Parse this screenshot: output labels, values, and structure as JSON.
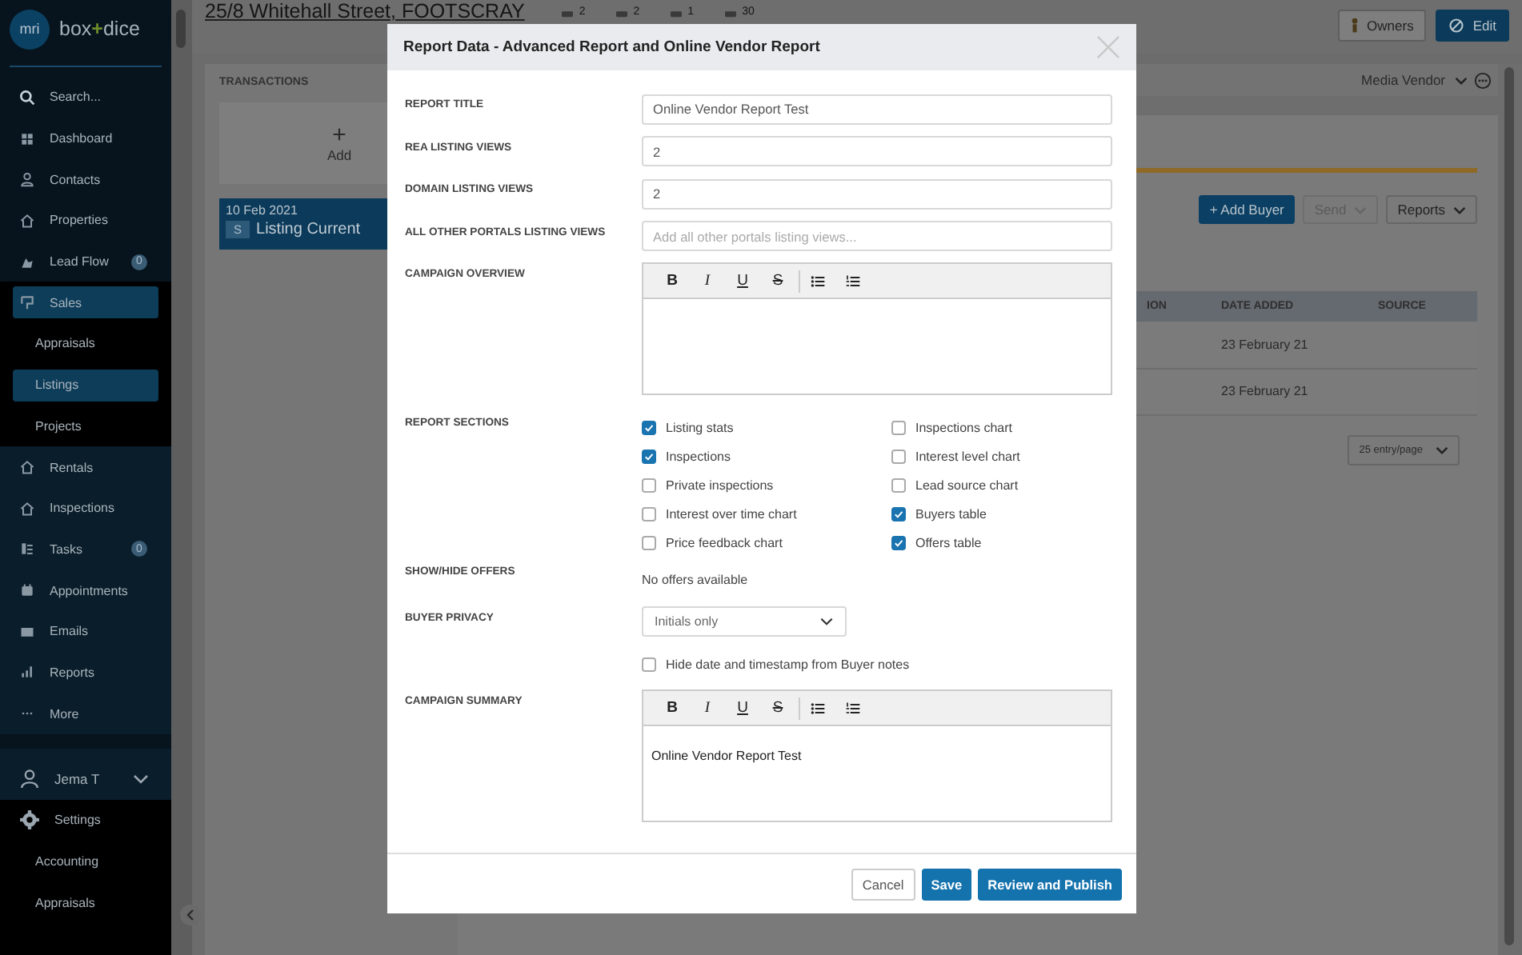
{
  "sidebar": {
    "logo": "mri",
    "brand": {
      "left": "box",
      "joiner": "+",
      "right": "dice"
    },
    "items": [
      {
        "label": "Search...",
        "selected": false
      },
      {
        "label": "Dashboard",
        "selected": false
      },
      {
        "label": "Contacts",
        "selected": false
      },
      {
        "label": "Properties",
        "selected": false
      },
      {
        "label": "Lead Flow",
        "badge": "0",
        "selected": false
      },
      {
        "label": "Sales",
        "selected": true,
        "children": [
          {
            "label": "Appraisals",
            "selected": false
          },
          {
            "label": "Listings",
            "selected": true
          },
          {
            "label": "Projects",
            "selected": false
          }
        ]
      },
      {
        "label": "Rentals",
        "selected": false
      },
      {
        "label": "Inspections",
        "selected": false
      },
      {
        "label": "Tasks",
        "badge": "0",
        "selected": false
      },
      {
        "label": "Appointments",
        "selected": false
      },
      {
        "label": "Emails",
        "selected": false
      },
      {
        "label": "Reports",
        "selected": false
      },
      {
        "label": "More",
        "selected": false
      }
    ],
    "user": {
      "name": "Jema T"
    },
    "settings": {
      "label": "Settings",
      "children": [
        {
          "label": "Accounting"
        },
        {
          "label": "Appraisals"
        }
      ]
    }
  },
  "header": {
    "title": "25/8 Whitehall Street, FOOTSCRAY",
    "stats": [
      "2",
      "2",
      "1",
      "30"
    ],
    "buttons": [
      {
        "label": "Owners",
        "kind": "secondary"
      },
      {
        "label": "Edit",
        "kind": "primary"
      }
    ]
  },
  "transactions": {
    "title": "TRANSACTIONS",
    "add_icon": "+",
    "add_label": "Add",
    "items": [
      {
        "date": "10 Feb 2021",
        "badge": "S",
        "status": "Listing Current",
        "selected": true
      }
    ]
  },
  "buyers": {
    "vendor_select": "Media Vendor",
    "actions": [
      {
        "label": "+ Add Buyer",
        "kind": "primary",
        "disabled": false
      },
      {
        "label": "Send",
        "kind": "dropdown",
        "disabled": true
      },
      {
        "label": "Reports",
        "kind": "dropdown",
        "disabled": false
      }
    ],
    "columns": [
      "ION",
      "DATE ADDED",
      "SOURCE"
    ],
    "rows": [
      {
        "date_added": "23 February 21"
      },
      {
        "date_added": "23 February 21"
      }
    ],
    "page_size": "25 entry/page"
  },
  "modal": {
    "title": "Report Data - Advanced Report and Online Vendor Report",
    "fields": [
      {
        "kind": "input",
        "label": "REPORT TITLE",
        "value": "Online Vendor Report Test"
      },
      {
        "kind": "input",
        "label": "REA LISTING VIEWS",
        "value": "2"
      },
      {
        "kind": "input",
        "label": "DOMAIN LISTING VIEWS",
        "value": "2"
      },
      {
        "kind": "input",
        "label": "ALL OTHER PORTALS LISTING VIEWS",
        "placeholder": "Add all other portals listing views..."
      },
      {
        "kind": "editor",
        "label": "CAMPAIGN OVERVIEW",
        "toolbar": [
          "B",
          "I",
          "U",
          "S"
        ]
      },
      {
        "kind": "checklist",
        "label": "REPORT SECTIONS",
        "options": [
          {
            "label": "Listing stats",
            "checked": true
          },
          {
            "label": "Inspections",
            "checked": true
          },
          {
            "label": "Private inspections",
            "checked": false
          },
          {
            "label": "Interest over time chart",
            "checked": false
          },
          {
            "label": "Price feedback chart",
            "checked": false
          },
          {
            "label": "Inspections chart",
            "checked": false
          },
          {
            "label": "Interest level chart",
            "checked": false
          },
          {
            "label": "Lead source chart",
            "checked": false
          },
          {
            "label": "Buyers table",
            "checked": true
          },
          {
            "label": "Offers table",
            "checked": true
          }
        ]
      },
      {
        "kind": "text",
        "label": "SHOW/HIDE OFFERS",
        "value": "No offers available"
      },
      {
        "kind": "select",
        "label": "BUYER PRIVACY",
        "value": "Initials only"
      },
      {
        "kind": "checkbox",
        "text": "Hide date and timestamp from Buyer notes",
        "checked": false
      },
      {
        "kind": "editor",
        "label": "CAMPAIGN SUMMARY",
        "toolbar": [
          "B",
          "I",
          "U",
          "S"
        ],
        "value": "Online Vendor Report Test"
      }
    ],
    "buttons": [
      {
        "label": "Cancel",
        "kind": "secondary"
      },
      {
        "label": "Save",
        "kind": "primary"
      },
      {
        "label": "Review and Publish",
        "kind": "primary"
      }
    ]
  }
}
